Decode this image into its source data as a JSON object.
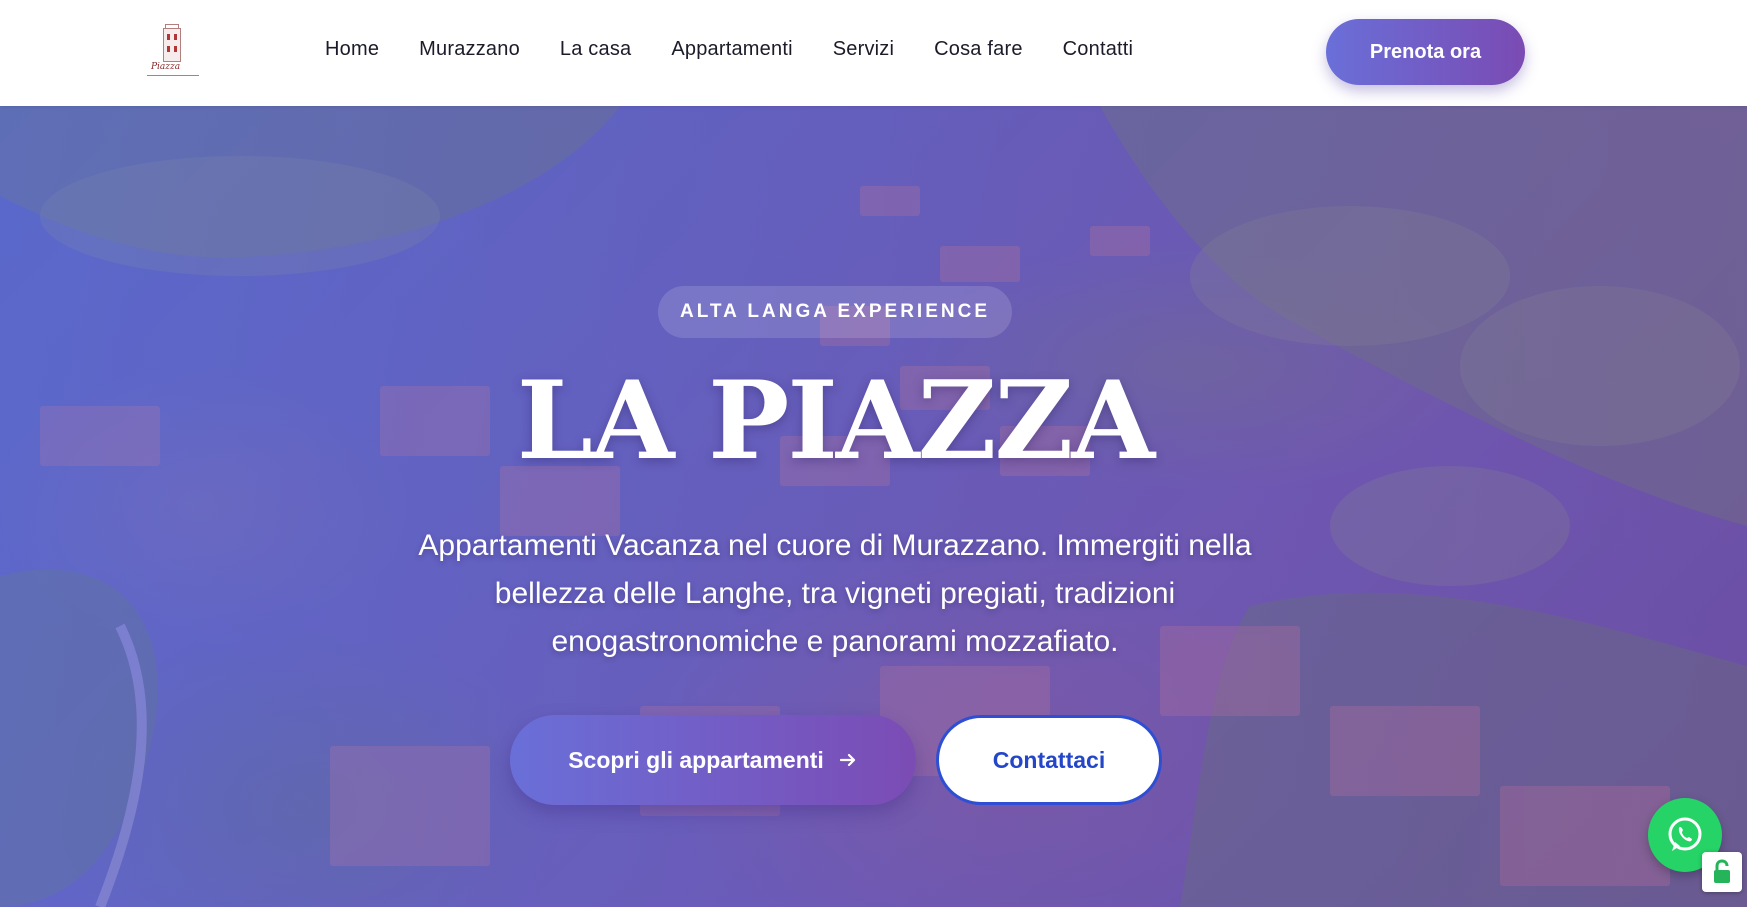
{
  "brand": {
    "logo_text": "Piazza",
    "logo_icon": "tower-logo-icon"
  },
  "nav": {
    "items": [
      {
        "label": "Home"
      },
      {
        "label": "Murazzano"
      },
      {
        "label": "La casa"
      },
      {
        "label": "Appartamenti"
      },
      {
        "label": "Servizi"
      },
      {
        "label": "Cosa fare"
      },
      {
        "label": "Contatti"
      }
    ],
    "cta_label": "Prenota ora"
  },
  "hero": {
    "tagline": "ALTA LANGA EXPERIENCE",
    "title": "LA PIAZZA",
    "subtitle": "Appartamenti Vacanza nel cuore di Murazzano. Immergiti nella bellezza delle Langhe, tra vigneti pregiati, tradizioni enogastronomiche e panorami mozzafiato.",
    "primary_button": "Scopri gli appartamenti",
    "primary_icon": "arrow-right-icon",
    "secondary_button": "Contattaci"
  },
  "floating": {
    "whatsapp_icon": "whatsapp-icon",
    "badge_icon": "lock-icon"
  },
  "colors": {
    "accent_start": "#6a6fd8",
    "accent_end": "#7a4bb3",
    "secondary_border": "#2e4fd4",
    "whatsapp": "#25d366"
  }
}
